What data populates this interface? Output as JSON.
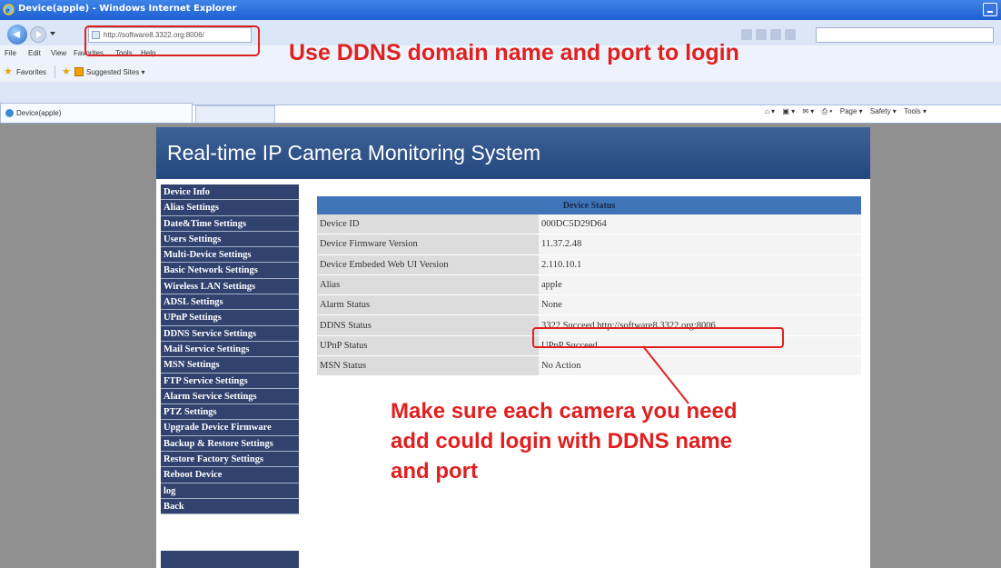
{
  "browser": {
    "window_title": "Device(apple) - Windows Internet Explorer",
    "address": "http://software8.3322.org:8006/",
    "menu": [
      "File",
      "Edit",
      "View",
      "Favorites",
      "Tools",
      "Help"
    ],
    "favorites_label": "Favorites",
    "suggested_sites_label": "Suggested Sites ▾",
    "tab_title": "Device(apple)",
    "command_bar": [
      "Page ▾",
      "Safety ▾",
      "Tools ▾"
    ]
  },
  "page": {
    "header_title": "Real-time IP Camera Monitoring System",
    "sidebar": [
      "Device Info",
      "Alias Settings",
      "Date&Time Settings",
      "Users Settings",
      "Multi-Device Settings",
      "Basic Network Settings",
      "Wireless LAN Settings",
      "ADSL Settings",
      "UPnP Settings",
      "DDNS Service Settings",
      "Mail Service Settings",
      "MSN Settings",
      "FTP Service Settings",
      "Alarm Service Settings",
      "PTZ Settings",
      "Upgrade Device Firmware",
      "Backup & Restore Settings",
      "Restore Factory Settings",
      "Reboot Device",
      "log",
      "Back"
    ],
    "table": {
      "title": "Device Status",
      "rows": [
        {
          "label": "Device ID",
          "value": "000DC5D29D64"
        },
        {
          "label": "Device Firmware Version",
          "value": "11.37.2.48"
        },
        {
          "label": "Device Embeded Web UI Version",
          "value": "2.110.10.1"
        },
        {
          "label": "Alias",
          "value": "apple"
        },
        {
          "label": "Alarm Status",
          "value": "None"
        },
        {
          "label": "DDNS Status",
          "value": "3322 Succeed  http://software8.3322.org:8006"
        },
        {
          "label": "UPnP Status",
          "value": "UPnP Succeed"
        },
        {
          "label": "MSN Status",
          "value": "No Action"
        }
      ]
    }
  },
  "annotations": {
    "top": "Use DDNS domain name and port to login",
    "bottom_lines": [
      "Make sure each camera you need",
      "add could login with DDNS name",
      "and port"
    ],
    "color": "#e02020"
  },
  "colors": {
    "header_bg": "#2e5289",
    "sidebar_bg": "#31426f",
    "table_header_bg": "#3f74b8"
  }
}
